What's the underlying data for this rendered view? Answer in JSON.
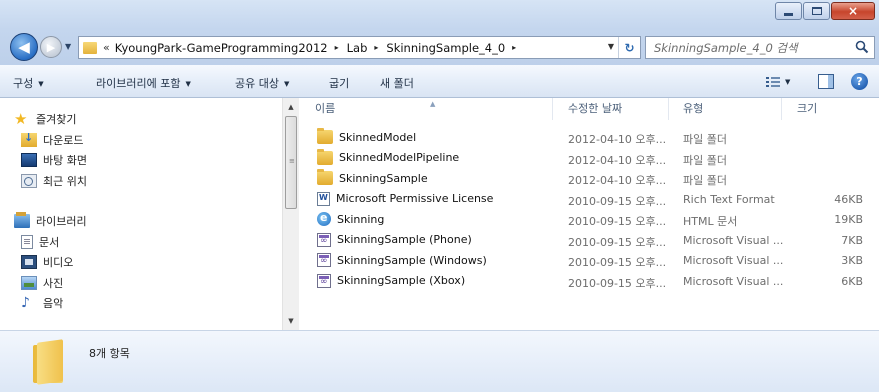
{
  "title_buttons": {
    "minimize": "minimize",
    "maximize": "maximize",
    "close": "×"
  },
  "address": {
    "chevron": "«",
    "crumbs": [
      "KyoungPark-GameProgramming2012",
      "Lab",
      "SkinningSample_4_0"
    ],
    "separator": "▸"
  },
  "search": {
    "placeholder": "SkinningSample_4_0 검색"
  },
  "commands": {
    "organize": "구성",
    "include_library": "라이브러리에 포함",
    "share_with": "공유 대상",
    "burn": "굽기",
    "new_folder": "새 폴더",
    "help": "?"
  },
  "navigation": {
    "favorites": "즐겨찾기",
    "downloads": "다운로드",
    "desktop": "바탕 화면",
    "recent": "최근 위치",
    "libraries": "라이브러리",
    "documents": "문서",
    "videos": "비디오",
    "pictures": "사진",
    "music": "음악"
  },
  "columns": {
    "name": "이름",
    "date": "수정한 날짜",
    "type": "유형",
    "size": "크기"
  },
  "files": [
    {
      "name": "SkinnedModel",
      "date": "2012-04-10 오후...",
      "type": "파일 폴더",
      "size": "",
      "icon": "folder-icon"
    },
    {
      "name": "SkinnedModelPipeline",
      "date": "2012-04-10 오후...",
      "type": "파일 폴더",
      "size": "",
      "icon": "folder-icon"
    },
    {
      "name": "SkinningSample",
      "date": "2012-04-10 오후...",
      "type": "파일 폴더",
      "size": "",
      "icon": "folder-icon"
    },
    {
      "name": "Microsoft Permissive License",
      "date": "2010-09-15 오후...",
      "type": "Rich Text Format",
      "size": "46KB",
      "icon": "rtf-document-icon"
    },
    {
      "name": "Skinning",
      "date": "2010-09-15 오후...",
      "type": "HTML 문서",
      "size": "19KB",
      "icon": "html-document-icon"
    },
    {
      "name": "SkinningSample (Phone)",
      "date": "2010-09-15 오후...",
      "type": "Microsoft Visual ...",
      "size": "7KB",
      "icon": "visual-studio-project-icon"
    },
    {
      "name": "SkinningSample (Windows)",
      "date": "2010-09-15 오후...",
      "type": "Microsoft Visual ...",
      "size": "3KB",
      "icon": "visual-studio-project-icon"
    },
    {
      "name": "SkinningSample (Xbox)",
      "date": "2010-09-15 오후...",
      "type": "Microsoft Visual ...",
      "size": "6KB",
      "icon": "visual-studio-project-icon"
    }
  ],
  "details": {
    "item_count": "8개 항목"
  }
}
